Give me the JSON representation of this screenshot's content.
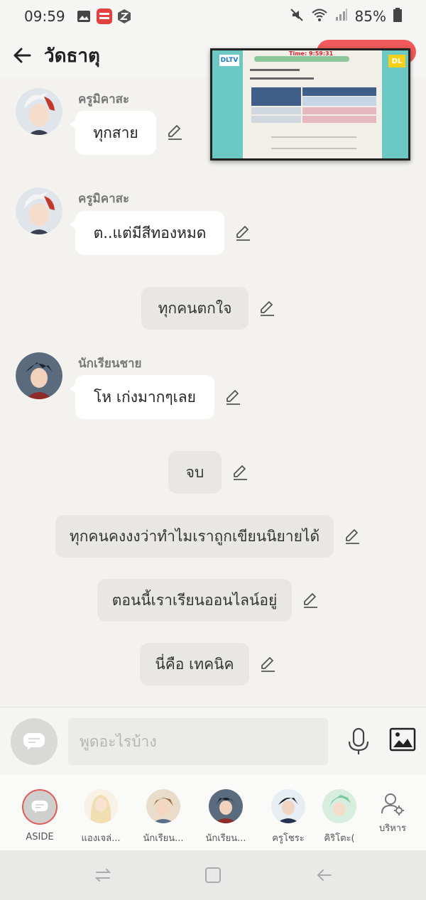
{
  "status_bar": {
    "time": "09:59",
    "battery": "85%",
    "app_badge": "MANGA\nTOON"
  },
  "header": {
    "title": "วัดธาตุ"
  },
  "pip": {
    "timer": "Time: 9:59:31",
    "logo_left": "DLTV",
    "logo_right": "DL"
  },
  "messages": [
    {
      "type": "character",
      "sender": "ครูมิคาสะ",
      "text": "ทุกสาย",
      "avatar": "white-red-hair"
    },
    {
      "type": "character",
      "sender": "ครูมิคาสะ",
      "text": "ต..แต่มีสีทองหมด",
      "avatar": "white-red-hair"
    },
    {
      "type": "narration",
      "text": "ทุกคนตกใจ"
    },
    {
      "type": "character",
      "sender": "นักเรียนชาย",
      "text": "โห เก่งมากๆเลย",
      "avatar": "dark-hair-boy"
    },
    {
      "type": "narration",
      "text": "จบ"
    },
    {
      "type": "narration",
      "text": "ทุกคนคงงงว่าทำไมเราถูกเขียนนิยายได้"
    },
    {
      "type": "narration",
      "text": "ตอนนี้เราเรียนออนไลน์อยู่"
    },
    {
      "type": "narration",
      "text": "นี่คือ เทคนิค"
    }
  ],
  "composer": {
    "placeholder": "พูดอะไรบ้าง"
  },
  "characters": [
    {
      "name": "ASIDE"
    },
    {
      "name": "แองเจล่..."
    },
    {
      "name": "นักเรียน..."
    },
    {
      "name": "นักเรียน..."
    },
    {
      "name": "ครูโชระ"
    },
    {
      "name": "คิริโตะ("
    },
    {
      "name": "บริหาร"
    }
  ],
  "colors": {
    "accent": "#e45b57",
    "bubble": "#ffffff",
    "narration": "#e8e7e3",
    "background": "#f3f2ee"
  }
}
